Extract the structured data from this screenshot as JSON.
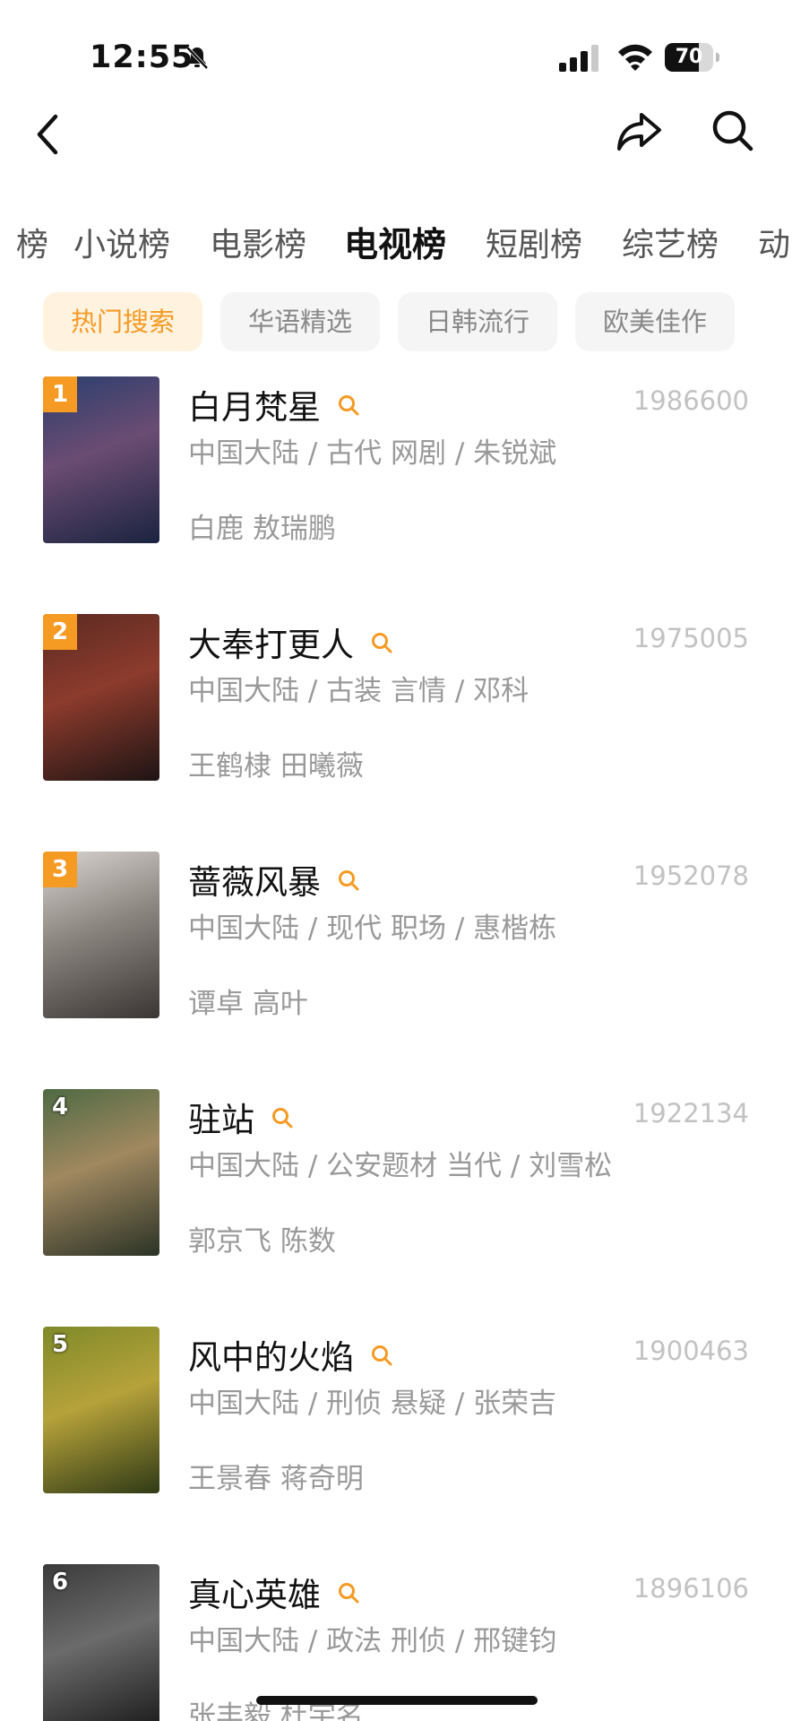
{
  "status_bar": {
    "time": "12:55",
    "battery": "70",
    "battery_level": 0.7
  },
  "nav": {
    "back_icon": "chevron-left-icon",
    "share_icon": "share-arrow-icon",
    "search_icon": "search-icon"
  },
  "category_tabs": {
    "items": [
      {
        "label": "榜"
      },
      {
        "label": "小说榜"
      },
      {
        "label": "电影榜"
      },
      {
        "label": "电视榜"
      },
      {
        "label": "短剧榜"
      },
      {
        "label": "综艺榜"
      },
      {
        "label": "动"
      }
    ],
    "active_index": 3
  },
  "filters": {
    "items": [
      {
        "label": "热门搜索"
      },
      {
        "label": "华语精选"
      },
      {
        "label": "日韩流行"
      },
      {
        "label": "欧美佳作"
      }
    ],
    "active_index": 0
  },
  "accent_color": "#f59a23",
  "rankings": [
    {
      "rank": "1",
      "title": "白月梵星",
      "count": "1986600",
      "meta": "中国大陆 / 古代 网剧 / 朱锐斌",
      "cast": "白鹿 敖瑞鹏",
      "poster_colors": [
        "#2a3f6e",
        "#1a2340",
        "#6b4c72"
      ]
    },
    {
      "rank": "2",
      "title": "大奉打更人",
      "count": "1975005",
      "meta": "中国大陆 / 古装 言情 / 邓科",
      "cast": "王鹤棣 田曦薇",
      "poster_colors": [
        "#5b2a22",
        "#1e1414",
        "#8c3b2c"
      ]
    },
    {
      "rank": "3",
      "title": "蔷薇风暴",
      "count": "1952078",
      "meta": "中国大陆 / 现代 职场 / 惠楷栋",
      "cast": "谭卓 高叶",
      "poster_colors": [
        "#d8d4cf",
        "#3a3634",
        "#8c8680"
      ]
    },
    {
      "rank": "4",
      "title": "驻站",
      "count": "1922134",
      "meta": "中国大陆 / 公安题材 当代 / 刘雪松",
      "cast": "郭京飞 陈数",
      "poster_colors": [
        "#4e6a43",
        "#2b3326",
        "#a08860"
      ]
    },
    {
      "rank": "5",
      "title": "风中的火焰",
      "count": "1900463",
      "meta": "中国大陆 / 刑侦 悬疑 / 张荣吉",
      "cast": "王景春 蒋奇明",
      "poster_colors": [
        "#7f8a2a",
        "#2f3a16",
        "#b6a23a"
      ]
    },
    {
      "rank": "6",
      "title": "真心英雄",
      "count": "1896106",
      "meta": "中国大陆 / 政法 刑侦 / 邢键钧",
      "cast": "张丰毅 杜宇名",
      "poster_colors": [
        "#3b3b3b",
        "#1a1a1a",
        "#6b6b6b"
      ]
    }
  ]
}
